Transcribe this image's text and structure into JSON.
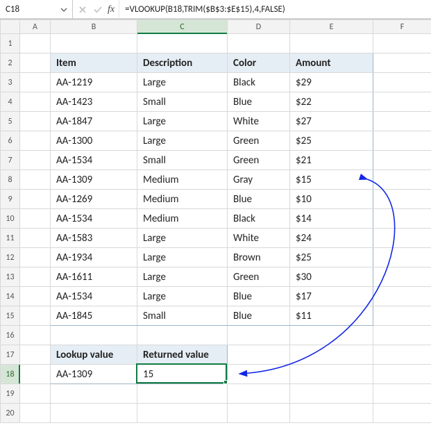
{
  "name_box": {
    "value": "C18"
  },
  "formula_bar": {
    "fx_label": "fx",
    "formula": "=VLOOKUP(B18,TRIM($B$3:$E$15),4,FALSE)"
  },
  "columns": [
    "A",
    "B",
    "C",
    "D",
    "E",
    "F"
  ],
  "rows": [
    1,
    2,
    3,
    4,
    5,
    6,
    7,
    8,
    9,
    10,
    11,
    12,
    13,
    14,
    15,
    16,
    17,
    18,
    19,
    20
  ],
  "active": {
    "col": "C",
    "row": 18
  },
  "table": {
    "headers": {
      "item": "Item",
      "description": "Description",
      "color": "Color",
      "amount": "Amount"
    },
    "rows": [
      {
        "item": "AA-1219",
        "description": "Large",
        "color": "Black",
        "amount": "$29"
      },
      {
        "item": "AA-1423",
        "description": "Small",
        "color": "Blue",
        "amount": "$22"
      },
      {
        "item": "AA-1847",
        "description": "Large",
        "color": "White",
        "amount": "$27"
      },
      {
        "item": "AA-1300",
        "description": "Large",
        "color": "Green",
        "amount": "$25"
      },
      {
        "item": "AA-1534",
        "description": "Small",
        "color": "Green",
        "amount": "$21"
      },
      {
        "item": "AA-1309",
        "description": "Medium",
        "color": "Gray",
        "amount": "$15"
      },
      {
        "item": "AA-1269",
        "description": "Medium",
        "color": "Blue",
        "amount": "$10"
      },
      {
        "item": "AA-1534",
        "description": "Medium",
        "color": "Black",
        "amount": "$14"
      },
      {
        "item": "AA-1583",
        "description": "Large",
        "color": "White",
        "amount": "$24"
      },
      {
        "item": "AA-1934",
        "description": "Large",
        "color": "Brown",
        "amount": "$25"
      },
      {
        "item": "AA-1611",
        "description": "Large",
        "color": "Green",
        "amount": "$30"
      },
      {
        "item": "AA-1534",
        "description": "Large",
        "color": "Blue",
        "amount": "$17"
      },
      {
        "item": "AA-1845",
        "description": "Small",
        "color": "Blue",
        "amount": "$11"
      }
    ]
  },
  "lookup": {
    "headers": {
      "lookup_value": "Lookup value",
      "returned_value": "Returned value"
    },
    "value": "AA-1309",
    "result": "15"
  },
  "colors": {
    "arrow": "#1227e6"
  },
  "chart_data": null
}
